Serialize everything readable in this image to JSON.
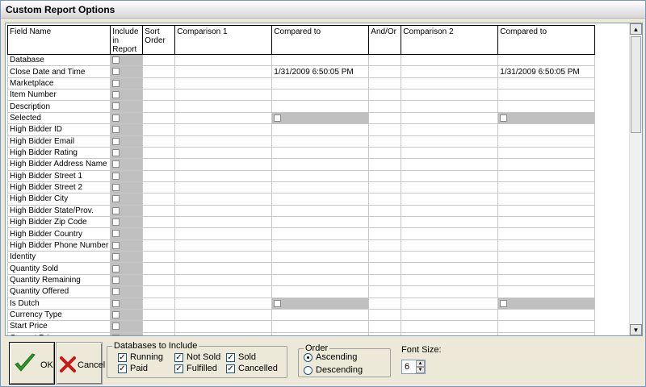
{
  "window": {
    "title": "Custom Report Options"
  },
  "grid": {
    "headers": [
      "Field Name",
      "Include in Report",
      "Sort Order",
      "Comparison 1",
      "Compared to",
      "And/Or",
      "Comparison 2",
      "Compared to"
    ],
    "rows": [
      {
        "field": "Database",
        "compared_to_1": "",
        "compared_to_2": "",
        "checkbox_compare": false
      },
      {
        "field": "Close Date and Time",
        "compared_to_1": "1/31/2009 6:50:05 PM",
        "compared_to_2": "1/31/2009 6:50:05 PM",
        "checkbox_compare": false
      },
      {
        "field": "Marketplace",
        "compared_to_1": "",
        "compared_to_2": "",
        "checkbox_compare": false
      },
      {
        "field": "Item Number",
        "compared_to_1": "",
        "compared_to_2": "",
        "checkbox_compare": false
      },
      {
        "field": "Description",
        "compared_to_1": "",
        "compared_to_2": "",
        "checkbox_compare": false
      },
      {
        "field": "Selected",
        "compared_to_1": "",
        "compared_to_2": "",
        "checkbox_compare": true
      },
      {
        "field": "High Bidder ID",
        "compared_to_1": "",
        "compared_to_2": "",
        "checkbox_compare": false
      },
      {
        "field": "High Bidder Email",
        "compared_to_1": "",
        "compared_to_2": "",
        "checkbox_compare": false
      },
      {
        "field": "High Bidder Rating",
        "compared_to_1": "",
        "compared_to_2": "",
        "checkbox_compare": false
      },
      {
        "field": "High Bidder Address Name",
        "compared_to_1": "",
        "compared_to_2": "",
        "checkbox_compare": false
      },
      {
        "field": "High Bidder Street 1",
        "compared_to_1": "",
        "compared_to_2": "",
        "checkbox_compare": false
      },
      {
        "field": "High Bidder Street 2",
        "compared_to_1": "",
        "compared_to_2": "",
        "checkbox_compare": false
      },
      {
        "field": "High Bidder City",
        "compared_to_1": "",
        "compared_to_2": "",
        "checkbox_compare": false
      },
      {
        "field": "High Bidder State/Prov.",
        "compared_to_1": "",
        "compared_to_2": "",
        "checkbox_compare": false
      },
      {
        "field": "High Bidder Zip Code",
        "compared_to_1": "",
        "compared_to_2": "",
        "checkbox_compare": false
      },
      {
        "field": "High Bidder Country",
        "compared_to_1": "",
        "compared_to_2": "",
        "checkbox_compare": false
      },
      {
        "field": "High Bidder Phone Number",
        "compared_to_1": "",
        "compared_to_2": "",
        "checkbox_compare": false
      },
      {
        "field": "Identity",
        "compared_to_1": "",
        "compared_to_2": "",
        "checkbox_compare": false
      },
      {
        "field": "Quantity Sold",
        "compared_to_1": "",
        "compared_to_2": "",
        "checkbox_compare": false
      },
      {
        "field": "Quantity Remaining",
        "compared_to_1": "",
        "compared_to_2": "",
        "checkbox_compare": false
      },
      {
        "field": "Quantity Offered",
        "compared_to_1": "",
        "compared_to_2": "",
        "checkbox_compare": false
      },
      {
        "field": "Is Dutch",
        "compared_to_1": "",
        "compared_to_2": "",
        "checkbox_compare": true
      },
      {
        "field": "Currency Type",
        "compared_to_1": "",
        "compared_to_2": "",
        "checkbox_compare": false
      },
      {
        "field": "Start Price",
        "compared_to_1": "",
        "compared_to_2": "",
        "checkbox_compare": false
      },
      {
        "field": "Current Price",
        "compared_to_1": "",
        "compared_to_2": "",
        "checkbox_compare": false
      }
    ]
  },
  "buttons": {
    "ok": "OK",
    "cancel": "Cancel"
  },
  "databases_group": {
    "legend": "Databases to Include",
    "options": [
      {
        "label": "Running",
        "checked": true
      },
      {
        "label": "Not Sold",
        "checked": true
      },
      {
        "label": "Sold",
        "checked": true
      },
      {
        "label": "Paid",
        "checked": true
      },
      {
        "label": "Fulfilled",
        "checked": true
      },
      {
        "label": "Cancelled",
        "checked": true
      }
    ]
  },
  "order_group": {
    "legend": "Order",
    "ascending": "Ascending",
    "descending": "Descending",
    "selected": "Ascending"
  },
  "font_size": {
    "label": "Font Size:",
    "value": "6"
  },
  "icons": {
    "ok": "green-checkmark-icon",
    "cancel": "red-x-icon"
  },
  "colors": {
    "grey_cell": "#c0c0c0",
    "ok_green": "#2e9a2e",
    "cancel_red": "#c81818"
  }
}
